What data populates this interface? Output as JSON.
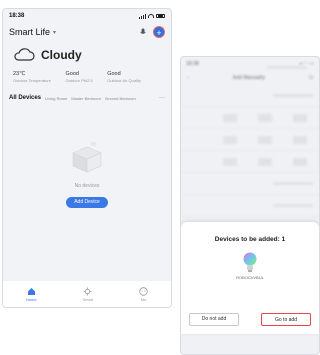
{
  "left": {
    "status": {
      "time": "18:38"
    },
    "header": {
      "home_name": "Smart Life",
      "caret": "▾"
    },
    "weather": {
      "condition": "Cloudy",
      "stats": [
        {
          "value": "23℃",
          "label": "Outdoor Temperature"
        },
        {
          "value": "Good",
          "label": "Outdoor PM2.5"
        },
        {
          "value": "Good",
          "label": "Outdoor Air Quality"
        }
      ]
    },
    "tabs": [
      "All Devices",
      "Living Room",
      "Master Bedroom",
      "Second Bedroom"
    ],
    "tab_more": "···",
    "empty": {
      "message": "No devices",
      "button": "Add Device"
    },
    "nav": [
      {
        "label": "Home",
        "icon": "home-icon"
      },
      {
        "label": "Smart",
        "icon": "smart-icon"
      },
      {
        "label": "Me",
        "icon": "me-icon"
      }
    ],
    "colors": {
      "accent": "#3a78e6",
      "highlight": "#e46a6a"
    }
  },
  "right": {
    "status": {
      "time": "18:38"
    },
    "header": {
      "title": "Add Manually",
      "back": "‹"
    },
    "dialog": {
      "title": "Devices to be added: 1",
      "device_name": "ROBOCI•VBUL",
      "cancel": "Do not add",
      "confirm": "Go to add"
    },
    "colors": {
      "confirm_border": "#e54848"
    }
  }
}
